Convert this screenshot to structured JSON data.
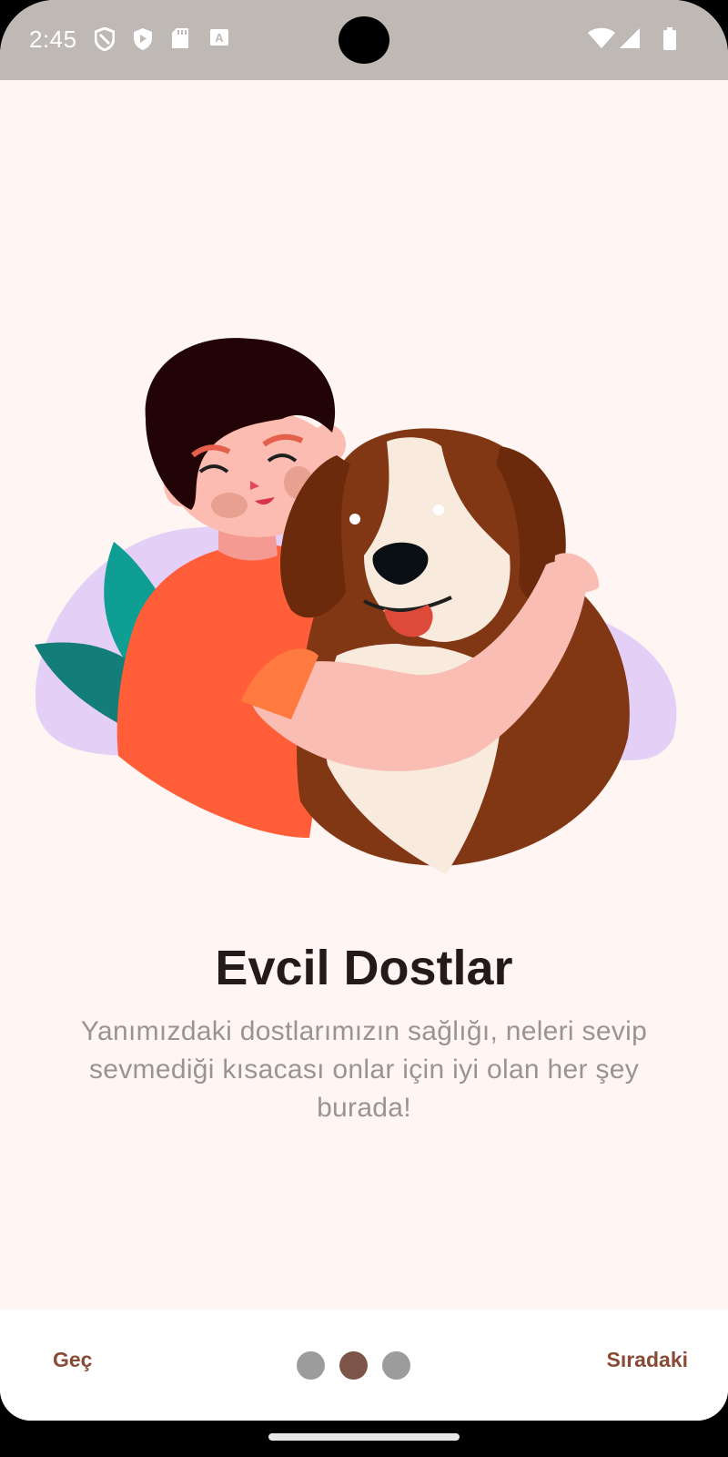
{
  "status_bar": {
    "time": "2:45",
    "left_icons": [
      "shield-outline-icon",
      "shield-play-icon",
      "play-badge-icon",
      "sd-card-icon",
      "text-a-icon"
    ],
    "right_icons": [
      "wifi-icon",
      "signal-icon",
      "battery-icon"
    ]
  },
  "onboarding": {
    "illustration": "boy-hugging-dog-illustration",
    "title": "Evcil Dostlar",
    "description": "Yanımızdaki dostlarımızın sağlığı, neleri sevip sevmediği kısacası onlar için iyi olan her şey burada!"
  },
  "bottom_nav": {
    "skip_label": "Geç",
    "next_label": "Sıradaki",
    "page_count": 3,
    "current_page": 2
  },
  "colors": {
    "background": "#FFF5F3",
    "accent": "#8A4B36",
    "dot_active": "#7C5548",
    "dot_inactive": "#9C9C9C",
    "title": "#221B19",
    "description": "#999494"
  }
}
